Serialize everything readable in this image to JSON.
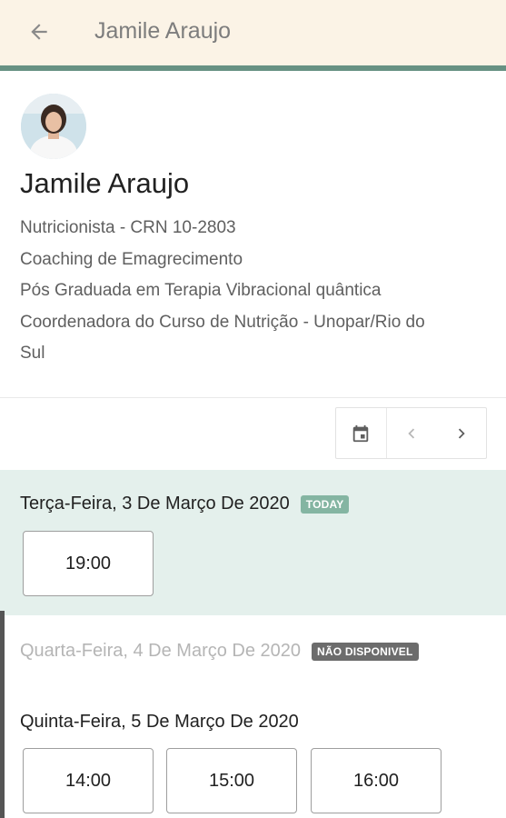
{
  "appbar": {
    "title": "Jamile Araujo",
    "back_icon": "arrow-left-icon"
  },
  "profile": {
    "name": "Jamile Araujo",
    "bio": [
      "Nutricionista - CRN 10-2803",
      "Coaching de Emagrecimento",
      "Pós Graduada em Terapia Vibracional quântica",
      "Coordenadora do Curso de Nutrição - Unopar/Rio do",
      "Sul"
    ]
  },
  "calendar_nav": {
    "icons": [
      "calendar-icon",
      "chevron-left-icon",
      "chevron-right-icon"
    ]
  },
  "days": [
    {
      "title": "Terça-Feira, 3 De Março De 2020",
      "badge": "TODAY",
      "slots": [
        "19:00"
      ]
    },
    {
      "title": "Quarta-Feira, 4 De Março De 2020",
      "badge": "NÃO DISPONIVEL",
      "slots": []
    },
    {
      "title": "Quinta-Feira, 5 De Março De 2020",
      "badge": "",
      "slots": [
        "14:00",
        "15:00",
        "16:00"
      ]
    }
  ],
  "colors": {
    "appbar_bg": "#fbf3e6",
    "accent": "#679183",
    "today_bg": "#e4f0ec",
    "today_badge": "#84b5a2"
  }
}
